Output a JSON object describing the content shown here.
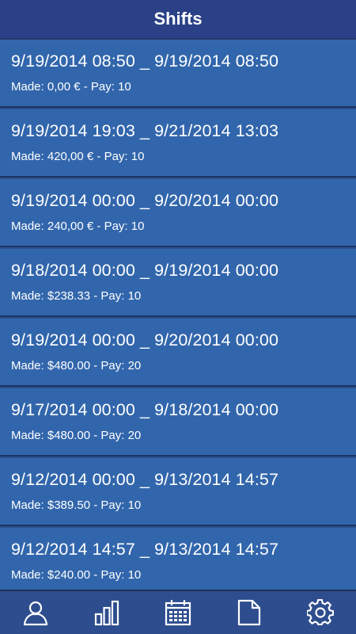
{
  "header": {
    "title": "Shifts"
  },
  "shifts": [
    {
      "dates": "9/19/2014 08:50 _ 9/19/2014 08:50",
      "summary": "Made: 0,00 € - Pay: 10"
    },
    {
      "dates": "9/19/2014 19:03 _ 9/21/2014 13:03",
      "summary": "Made: 420,00 € - Pay: 10"
    },
    {
      "dates": "9/19/2014 00:00 _ 9/20/2014 00:00",
      "summary": "Made: 240,00 € - Pay: 10"
    },
    {
      "dates": "9/18/2014 00:00 _ 9/19/2014 00:00",
      "summary": "Made: $238.33 - Pay: 10"
    },
    {
      "dates": "9/19/2014 00:00 _ 9/20/2014 00:00",
      "summary": "Made: $480.00 - Pay: 20"
    },
    {
      "dates": "9/17/2014 00:00 _ 9/18/2014 00:00",
      "summary": "Made: $480.00 - Pay: 20"
    },
    {
      "dates": "9/12/2014 00:00 _ 9/13/2014 14:57",
      "summary": "Made: $389.50 - Pay: 10"
    },
    {
      "dates": "9/12/2014 14:57 _ 9/13/2014 14:57",
      "summary": "Made: $240.00 - Pay: 10"
    }
  ],
  "tabbar": {
    "tabs": [
      {
        "icon": "profile-icon"
      },
      {
        "icon": "bar-chart-icon"
      },
      {
        "icon": "calendar-icon"
      },
      {
        "icon": "document-icon"
      },
      {
        "icon": "gear-icon"
      }
    ]
  },
  "colors": {
    "header_bg": "#2a4187",
    "item_bg": "#3266ac",
    "separator": "#1d3464",
    "tabbar_bg": "#2e4d8e",
    "text": "#ffffff"
  }
}
